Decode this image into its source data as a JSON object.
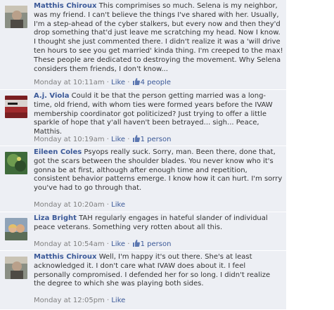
{
  "comments": [
    {
      "author": "Matthis Chiroux",
      "text": "This comprimises so much. Selena is my neighbor, was my friend. I can't believe the things I've shared with her. Usually, I'm a step-ahead of the cyber stalkers, but every now and then they'd drop something that'd just leave me scratching my head. Now I know. I thought she just commented there. I didn't realize it was a 'will drive ten hours to see you get married' kinda thing. I'm creeped to the max! These people are dedicated to destroying the movement. Why Selena considers them friends, I don't know...",
      "timestamp": "Monday at 10:11am",
      "like_label": "Like",
      "likes": "4 people"
    },
    {
      "author": "A.j. Viola",
      "text": "Could it be that the person getting married was a long-time, old friend, with whom ties were formed years before the IVAW membership coordinator got politicized? Just trying to offer a little sparkle of hope that y'all haven't been betrayed... sigh... Peace, Matthis.",
      "timestamp": "Monday at 10:19am",
      "like_label": "Like",
      "likes": "1 person"
    },
    {
      "author": "Eileen Coles",
      "text": "Psyops really suck. Sorry, man. Been there, done that, got the scars between the shoulder blades. You never know who it's gonna be at first, although after enough time and repetition, consistent behavior patterns emerge. I know how it can hurt. I'm sorry you've had to go through that.",
      "timestamp": "Monday at 10:20am",
      "like_label": "Like",
      "likes": ""
    },
    {
      "author": "Liza Bright",
      "text": "TAH regularly engages in hateful slander of individual peace veterans. Something very rotten about all this.",
      "timestamp": "Monday at 10:54am",
      "like_label": "Like",
      "likes": "1 person"
    },
    {
      "author": "Matthis Chiroux",
      "text": "Well, I'm happy it's out there. She's at least acknowledged it. I don't care what IVAW does about it. I feel personally compromised. I defended her for so long. I didn't realize the degree to which she was playing both sides.",
      "timestamp": "Monday at 12:05pm",
      "like_label": "Like",
      "likes": ""
    }
  ],
  "separator": "·",
  "icons": {
    "avatar": "profile-photo",
    "likes": "thumbs-up-icon"
  },
  "colors": {
    "link": "#3b5998",
    "comment_bg": "#edeff4",
    "meta": "#808080"
  }
}
